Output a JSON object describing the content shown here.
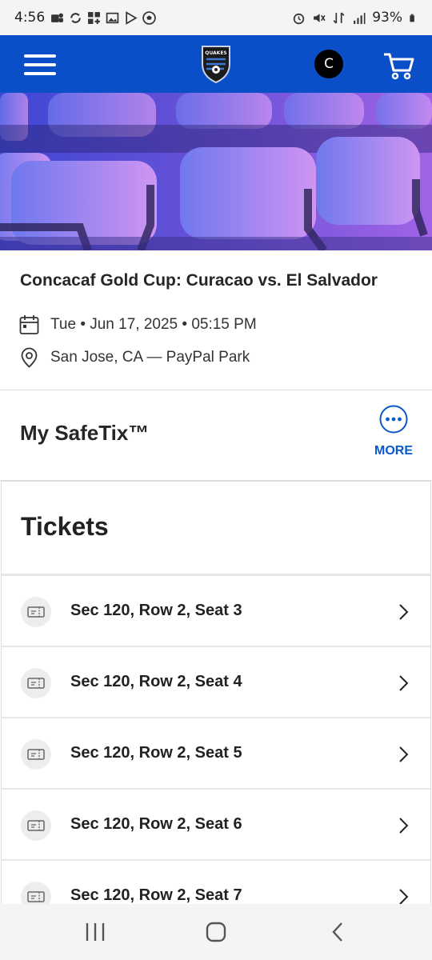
{
  "status_bar": {
    "time": "4:56",
    "battery": "93%",
    "left_icons": [
      "teams-icon",
      "sync-icon",
      "apps-icon",
      "gallery-icon",
      "play-store-icon",
      "soccer-ball-icon"
    ],
    "right_icons": [
      "alarm-icon",
      "mute-icon",
      "data-icon",
      "signal-icon",
      "battery-icon"
    ]
  },
  "header": {
    "logo_text": "QUAKES",
    "avatar_initial": "C",
    "brand_color": "#0a4fc8"
  },
  "event": {
    "title": "Concacaf Gold Cup: Curacao vs. El Salvador",
    "datetime": "Tue • Jun 17, 2025 • 05:15 PM",
    "location": "San Jose, CA — PayPal Park"
  },
  "safetix": {
    "title": "My SafeTix™",
    "more_label": "MORE"
  },
  "tickets": {
    "title": "Tickets",
    "rows": [
      "Sec 120, Row 2, Seat 3",
      "Sec 120, Row 2, Seat 4",
      "Sec 120, Row 2, Seat 5",
      "Sec 120, Row 2, Seat 6",
      "Sec 120, Row 2, Seat 7"
    ]
  }
}
